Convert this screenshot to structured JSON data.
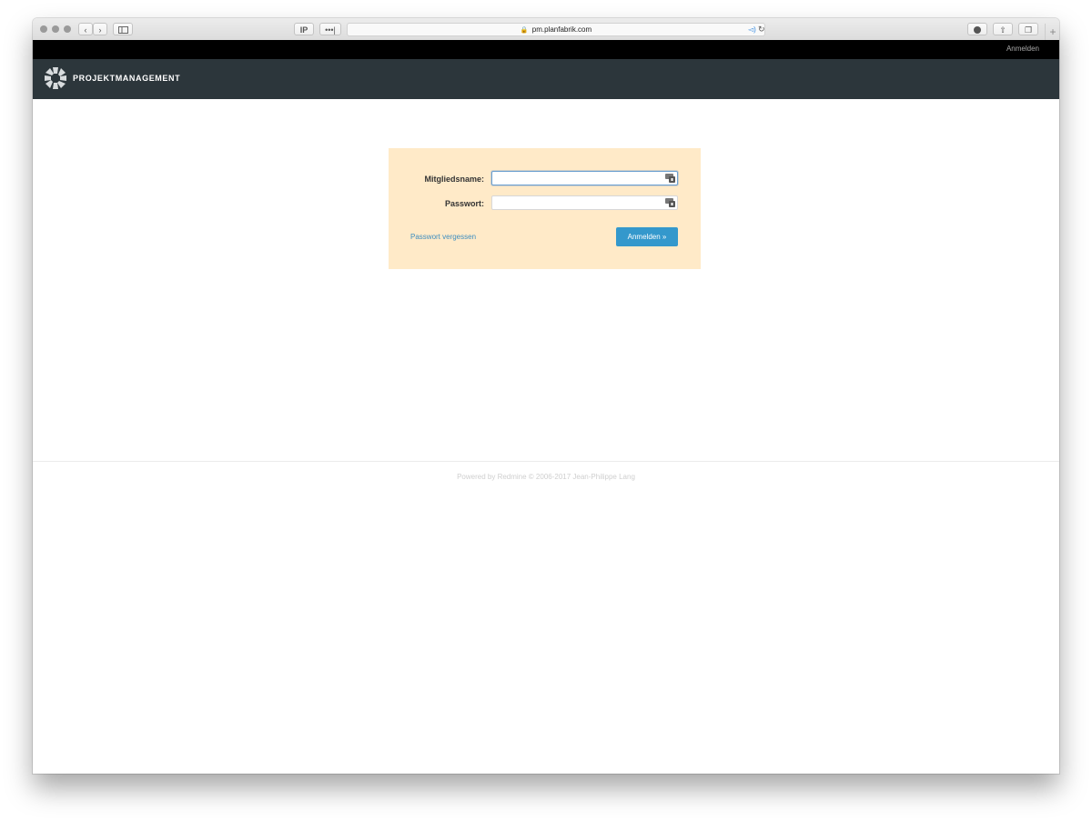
{
  "browser": {
    "url": "pm.planfabrik.com",
    "ip_button": "IP",
    "dots_button": "•••|"
  },
  "topbar": {
    "login_link": "Anmelden"
  },
  "header": {
    "title": "PROJEKTMANAGEMENT"
  },
  "login": {
    "username_label": "Mitgliedsname:",
    "username_value": "",
    "password_label": "Passwort:",
    "password_value": "",
    "forgot_link": "Passwort vergessen",
    "submit_label": "Anmelden »"
  },
  "footer": {
    "prefix": "Powered by ",
    "link": "Redmine",
    "suffix": " © 2006-2017 Jean-Philippe Lang"
  },
  "colors": {
    "header_bg": "#2c363b",
    "topbar_bg": "#000000",
    "login_box_bg": "#ffeac8",
    "button_bg": "#3498cc",
    "link": "#3d8dbf"
  }
}
